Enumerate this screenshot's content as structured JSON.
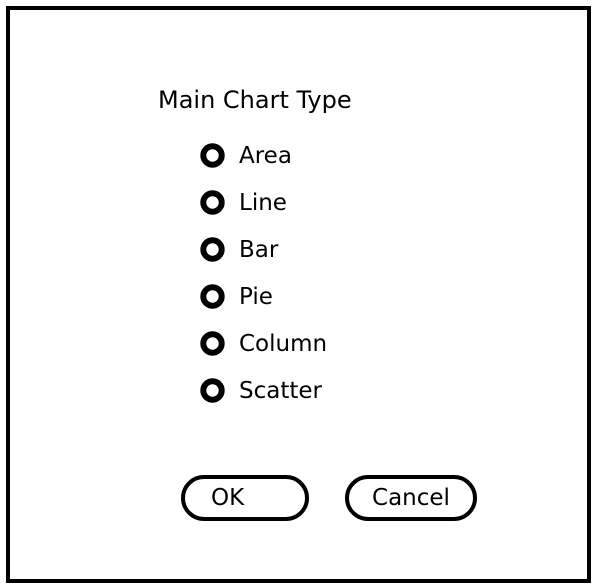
{
  "dialog": {
    "group_title": "Main Chart Type",
    "options": [
      {
        "label": "Area",
        "icon": "radio-button-icon"
      },
      {
        "label": "Line",
        "icon": "radio-button-icon"
      },
      {
        "label": "Bar",
        "icon": "radio-button-icon"
      },
      {
        "label": "Pie",
        "icon": "radio-button-icon"
      },
      {
        "label": "Column",
        "icon": "radio-button-icon"
      },
      {
        "label": "Scatter",
        "icon": "radio-button-icon"
      }
    ],
    "ok_label": "OK",
    "cancel_label": "Cancel"
  },
  "colors": {
    "foreground": "#000000",
    "background": "#ffffff"
  }
}
